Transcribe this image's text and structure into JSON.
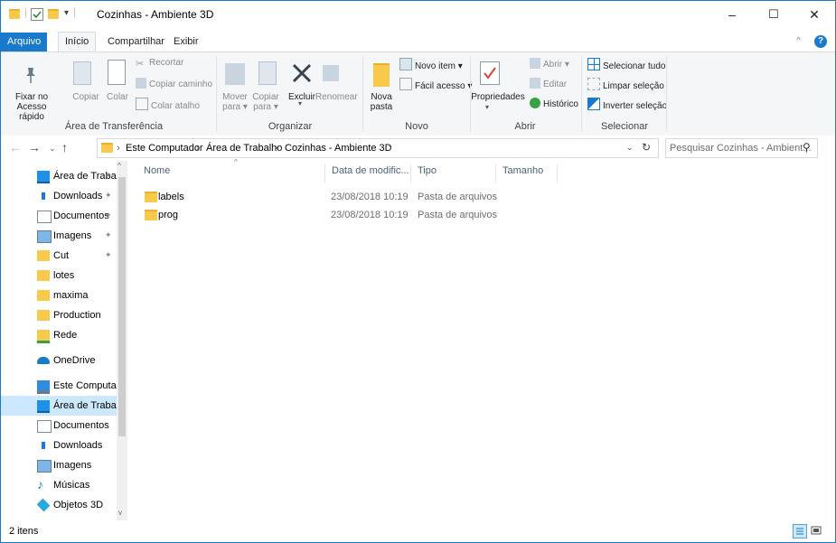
{
  "window": {
    "title": "Cozinhas - Ambiente 3D",
    "controls": {
      "minimize": "–",
      "maximize": "☐",
      "close": "✕"
    }
  },
  "ribbon_tabs": [
    "Arquivo",
    "Início",
    "Compartilhar",
    "Exibir"
  ],
  "ribbon": {
    "clipboard": {
      "label": "Área de Transferência",
      "pin_line1": "Fixar no",
      "pin_line2": "Acesso rápido",
      "copy": "Copiar",
      "paste": "Colar",
      "cut": "Recortar",
      "copy_path": "Copiar caminho",
      "paste_shortcut": "Colar atalho"
    },
    "organize": {
      "label": "Organizar",
      "move_to_1": "Mover",
      "move_to_2": "para ▾",
      "copy_to_1": "Copiar",
      "copy_to_2": "para ▾",
      "delete": "Excluir",
      "rename": "Renomear"
    },
    "new": {
      "label": "Novo",
      "new_folder_1": "Nova",
      "new_folder_2": "pasta",
      "new_item": "Novo item ▾",
      "easy_access": "Fácil acesso ▾"
    },
    "open": {
      "label": "Abrir",
      "properties": "Propriedades",
      "open": "Abrir ▾",
      "edit": "Editar",
      "history": "Histórico"
    },
    "select": {
      "label": "Selecionar",
      "select_all": "Selecionar tudo",
      "select_none": "Limpar seleção",
      "invert": "Inverter seleção"
    }
  },
  "address": {
    "crumbs": [
      "Este Computador",
      "Área de Trabalho",
      "Cozinhas - Ambiente 3D"
    ],
    "search_placeholder": "Pesquisar Cozinhas - Ambient..."
  },
  "nav_pane": [
    {
      "label": "Área de Traba",
      "icon": "desktop-icon",
      "pinned": true
    },
    {
      "label": "Downloads",
      "icon": "downloads-icon",
      "pinned": true
    },
    {
      "label": "Documentos",
      "icon": "documents-icon",
      "pinned": true
    },
    {
      "label": "Imagens",
      "icon": "images-icon",
      "pinned": true
    },
    {
      "label": "Cut",
      "icon": "folder-icon",
      "pinned": true
    },
    {
      "label": "lotes",
      "icon": "folder-icon"
    },
    {
      "label": "maxima",
      "icon": "folder-icon"
    },
    {
      "label": "Production",
      "icon": "folder-icon"
    },
    {
      "label": "Rede",
      "icon": "network-folder-icon"
    },
    {
      "label": "OneDrive",
      "icon": "onedrive-icon"
    },
    {
      "label": "Este Computador",
      "icon": "computer-icon"
    },
    {
      "label": "Área de Trabalho",
      "icon": "desktop-icon",
      "selected": true
    },
    {
      "label": "Documentos",
      "icon": "documents-icon"
    },
    {
      "label": "Downloads",
      "icon": "downloads-icon"
    },
    {
      "label": "Imagens",
      "icon": "images-icon"
    },
    {
      "label": "Músicas",
      "icon": "music-icon"
    },
    {
      "label": "Objetos 3D",
      "icon": "objects-3d-icon"
    }
  ],
  "columns": [
    "Nome",
    "Data de modific...",
    "Tipo",
    "Tamanho"
  ],
  "files": [
    {
      "name": "labels",
      "date": "23/08/2018 10:19",
      "type": "Pasta de arquivos"
    },
    {
      "name": "prog",
      "date": "23/08/2018 10:19",
      "type": "Pasta de arquivos"
    }
  ],
  "status": {
    "count": "2 itens"
  },
  "colors": {
    "accent": "#1979ca",
    "folder": "#f8c94a",
    "selected": "#cce8ff"
  }
}
